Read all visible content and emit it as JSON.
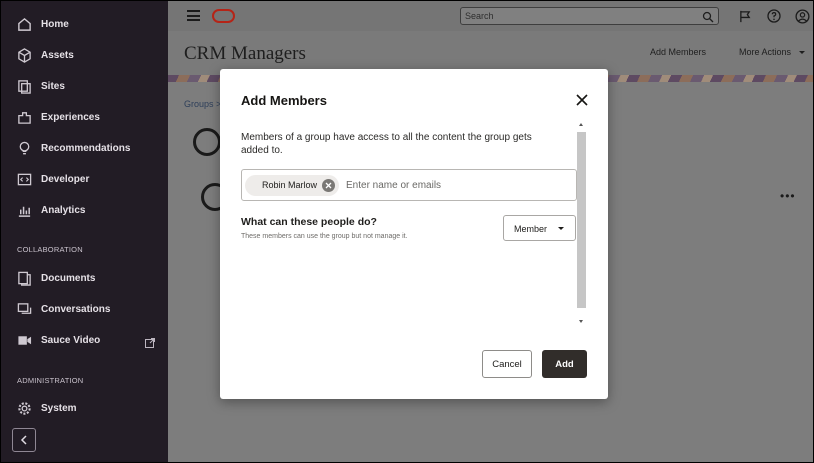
{
  "sidebar": {
    "items": [
      {
        "label": "Home",
        "icon": "home-icon"
      },
      {
        "label": "Assets",
        "icon": "cube-icon"
      },
      {
        "label": "Sites",
        "icon": "sites-icon"
      },
      {
        "label": "Experiences",
        "icon": "puzzle-icon"
      },
      {
        "label": "Recommendations",
        "icon": "lightbulb-icon"
      },
      {
        "label": "Developer",
        "icon": "code-icon"
      },
      {
        "label": "Analytics",
        "icon": "chart-icon"
      }
    ],
    "collaboration_label": "COLLABORATION",
    "collab_items": [
      {
        "label": "Documents",
        "icon": "documents-icon"
      },
      {
        "label": "Conversations",
        "icon": "conversations-icon"
      },
      {
        "label": "Sauce Video",
        "icon": "video-icon"
      }
    ],
    "administration_label": "ADMINISTRATION",
    "admin_items": [
      {
        "label": "System",
        "icon": "gear-icon"
      }
    ]
  },
  "header": {
    "search_placeholder": "Search"
  },
  "page": {
    "title": "CRM Managers",
    "add_members_link": "Add Members",
    "more_actions": "More Actions",
    "breadcrumb": "Groups >"
  },
  "modal": {
    "title": "Add Members",
    "description": "Members of a group have access to all the content the group gets added to.",
    "chip_label": "Robin Marlow",
    "input_placeholder": "Enter name or emails",
    "question": "What can these people do?",
    "question_sub": "These members can use the group but not manage it.",
    "role_value": "Member",
    "cancel_label": "Cancel",
    "add_label": "Add"
  }
}
